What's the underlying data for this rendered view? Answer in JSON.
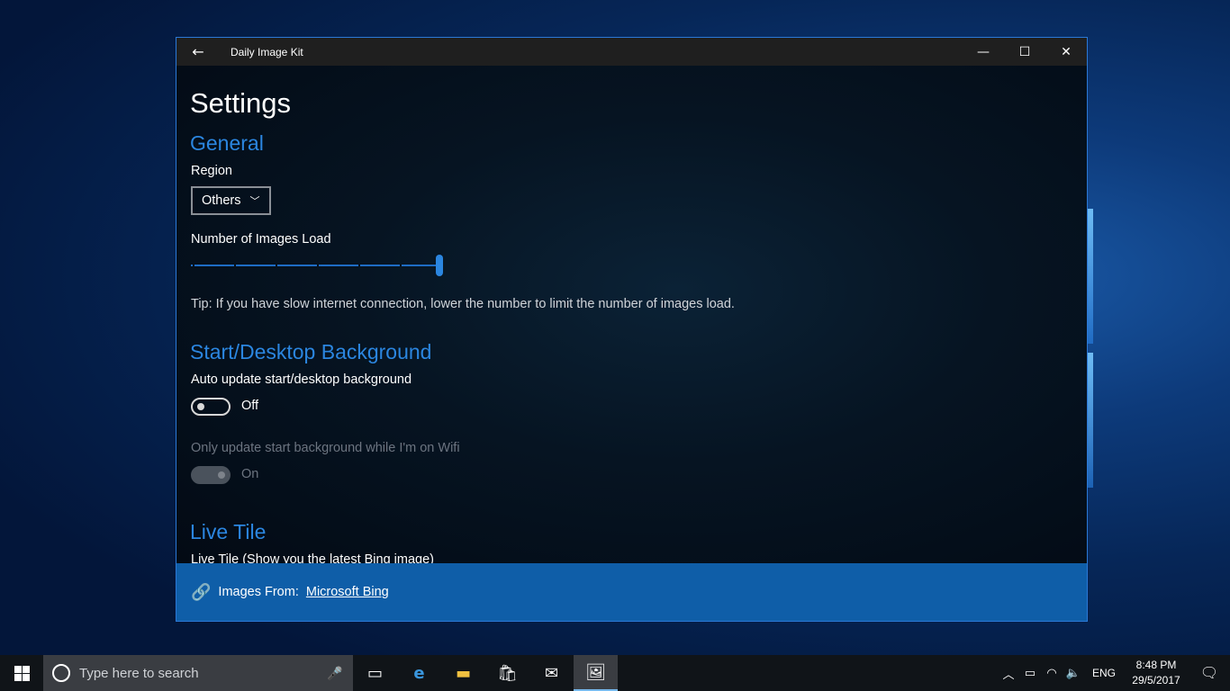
{
  "window": {
    "title": "Daily Image Kit",
    "back_glyph": "←",
    "minimize_glyph": "—",
    "maximize_glyph": "☐",
    "close_glyph": "✕"
  },
  "page": {
    "title": "Settings"
  },
  "general": {
    "heading": "General",
    "region_label": "Region",
    "region_value": "Others",
    "images_load_label": "Number of Images Load",
    "images_load_fraction": 1.0,
    "tip": "Tip: If you have slow internet connection, lower the number to limit the number of images load."
  },
  "background": {
    "heading": "Start/Desktop Background",
    "auto_update_label": "Auto update start/desktop background",
    "auto_update_state": "Off",
    "wifi_only_label": "Only update start background while I'm on Wifi",
    "wifi_only_state": "On"
  },
  "live_tile": {
    "heading": "Live Tile",
    "description": "Live Tile (Show you the latest Bing image)"
  },
  "footer": {
    "prefix": "Images From:",
    "link": "Microsoft Bing"
  },
  "taskbar": {
    "search_placeholder": "Type here to search",
    "language": "ENG",
    "time": "8:48 PM",
    "date": "29/5/2017"
  },
  "colors": {
    "accent": "#2b86e0",
    "footer": "#0f5ea8",
    "window_border": "#2b78d6"
  }
}
